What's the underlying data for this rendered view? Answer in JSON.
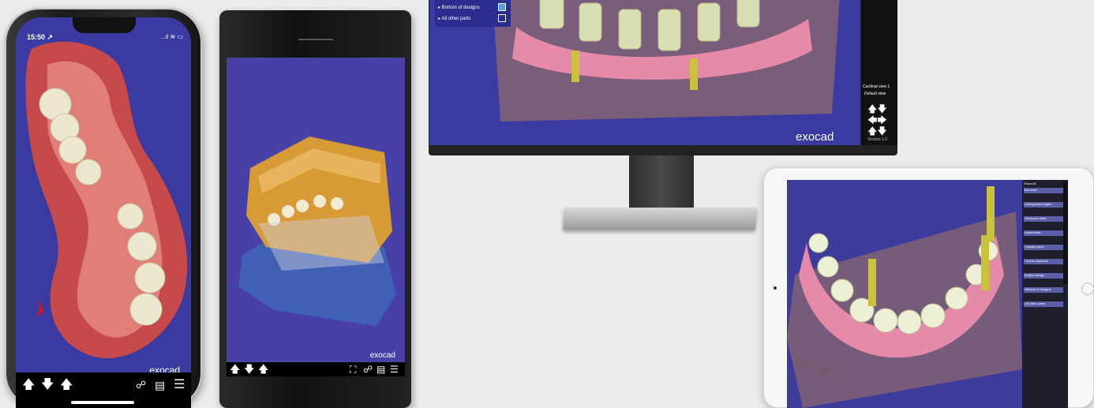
{
  "iphone": {
    "time": "15:50 ↗",
    "status": "..ıl ≋ ▭",
    "logo": "exocad",
    "nav_icons": [
      "arrow-up-icon",
      "arrow-down-icon",
      "arrow-up-icon"
    ],
    "tool_icons": [
      "visibility-toggle-icon",
      "list-icon",
      "menu-icon"
    ]
  },
  "android": {
    "logo": "exocad",
    "nav_icons": [
      "arrow-up-icon",
      "arrow-down-icon",
      "arrow-up-icon"
    ],
    "tool_icons": [
      "fullscreen-icon",
      "visibility-toggle-icon",
      "list-icon",
      "menu-icon"
    ]
  },
  "monitor": {
    "panel_rows": [
      "▸ Bottom of designs",
      "▸ All other parts"
    ],
    "view_label": "Cardinal view 1",
    "view_sublabel": "Default view",
    "logo": "exocad",
    "version": "Version 1.0"
  },
  "tablet": {
    "panel_title": "Show All",
    "panel_rows": [
      "Jaw scan",
      "• Antagonist images",
      "• Reduced teeth",
      "• Abutments",
      "• Implant parts",
      "• Screw channels",
      "Gingiva design",
      "• Bottom of designs",
      "• All other parts"
    ],
    "watermark": "Dec 2017"
  },
  "colors": {
    "screen_bg": "#3b3aa0",
    "gingiva": "#e58aa8",
    "tooth": "#e9ead2",
    "implant": "#c9c23a",
    "model": "#d89a35"
  }
}
